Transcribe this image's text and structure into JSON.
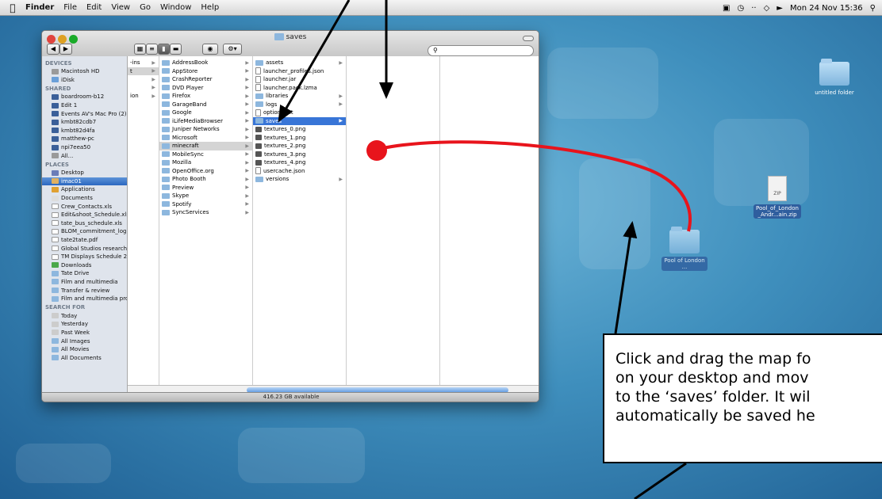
{
  "menubar": {
    "apple": "",
    "items": [
      "Finder",
      "File",
      "Edit",
      "View",
      "Go",
      "Window",
      "Help"
    ],
    "clock": "Mon 24 Nov 15:36"
  },
  "finder": {
    "title": "saves",
    "status": "416.23 GB available",
    "sidebar": [
      {
        "type": "head",
        "label": "DEVICES"
      },
      {
        "label": "Macintosh HD",
        "icon": "hard-drive-icon"
      },
      {
        "label": "iDisk",
        "icon": "idisk-icon"
      },
      {
        "type": "head",
        "label": "SHARED"
      },
      {
        "label": "boardroom-b12",
        "icon": "computer-icon"
      },
      {
        "label": "Edit 1",
        "icon": "computer-icon"
      },
      {
        "label": "Events AV's Mac Pro (2)",
        "icon": "computer-icon"
      },
      {
        "label": "kmbt82cdb7",
        "icon": "computer-icon"
      },
      {
        "label": "kmbt82d4fa",
        "icon": "computer-icon"
      },
      {
        "label": "matthew-pc",
        "icon": "computer-icon"
      },
      {
        "label": "npi7eea50",
        "icon": "computer-icon"
      },
      {
        "label": "All...",
        "icon": "network-icon"
      },
      {
        "type": "head",
        "label": "PLACES"
      },
      {
        "label": "Desktop",
        "icon": "desktop-icon"
      },
      {
        "label": "imac01",
        "icon": "home-icon",
        "selected": true
      },
      {
        "label": "Applications",
        "icon": "applications-icon"
      },
      {
        "label": "Documents",
        "icon": "documents-icon"
      },
      {
        "label": "Crew_Contacts.xls",
        "icon": "document-icon"
      },
      {
        "label": "Edit&shoot_Schedule.xls",
        "icon": "document-icon"
      },
      {
        "label": "tate_bus_schedule.xls",
        "icon": "document-icon"
      },
      {
        "label": "BLOM_commitment_log ...",
        "icon": "document-icon"
      },
      {
        "label": "tate2tate.pdf",
        "icon": "pdf-icon"
      },
      {
        "label": "Global Studios research ...",
        "icon": "document-icon"
      },
      {
        "label": "TM Displays Schedule 20...",
        "icon": "document-icon"
      },
      {
        "label": "Downloads",
        "icon": "downloads-icon"
      },
      {
        "label": "Tate Drive",
        "icon": "folder-icon"
      },
      {
        "label": "Film and multimedia",
        "icon": "folder-icon"
      },
      {
        "label": "Transfer & review",
        "icon": "folder-icon"
      },
      {
        "label": "Film and multimedia pro...",
        "icon": "folder-icon"
      },
      {
        "type": "head",
        "label": "SEARCH FOR"
      },
      {
        "label": "Today",
        "icon": "clock-icon"
      },
      {
        "label": "Yesterday",
        "icon": "clock-icon"
      },
      {
        "label": "Past Week",
        "icon": "clock-icon"
      },
      {
        "label": "All Images",
        "icon": "folder-icon"
      },
      {
        "label": "All Movies",
        "icon": "folder-icon"
      },
      {
        "label": "All Documents",
        "icon": "folder-icon"
      }
    ],
    "col1_fragments": [
      "-ins",
      "t",
      "",
      "",
      "ion"
    ],
    "col2": [
      "AddressBook",
      "AppStore",
      "CrashReporter",
      "DVD Player",
      "Firefox",
      "GarageBand",
      "Google",
      "iLifeMediaBrowser",
      "Juniper Networks",
      "Microsoft",
      "minecraft",
      "MobileSync",
      "Mozilla",
      "OpenOffice.org",
      "Photo Booth",
      "Preview",
      "Skype",
      "Spotify",
      "SyncServices"
    ],
    "col2_selected": "minecraft",
    "col3": [
      {
        "label": "assets",
        "kind": "folder"
      },
      {
        "label": "launcher_profiles.json",
        "kind": "doc"
      },
      {
        "label": "launcher.jar",
        "kind": "doc"
      },
      {
        "label": "launcher.pack.lzma",
        "kind": "doc"
      },
      {
        "label": "libraries",
        "kind": "folder"
      },
      {
        "label": "logs",
        "kind": "folder"
      },
      {
        "label": "options.txt",
        "kind": "doc"
      },
      {
        "label": "saves",
        "kind": "folder",
        "highlight": true
      },
      {
        "label": "textures_0.png",
        "kind": "img"
      },
      {
        "label": "textures_1.png",
        "kind": "img"
      },
      {
        "label": "textures_2.png",
        "kind": "img"
      },
      {
        "label": "textures_3.png",
        "kind": "img"
      },
      {
        "label": "textures_4.png",
        "kind": "img"
      },
      {
        "label": "usercache.json",
        "kind": "doc"
      },
      {
        "label": "versions",
        "kind": "folder"
      }
    ]
  },
  "desktop": {
    "untitled_folder": "untitled folder",
    "zip_label_1": "Pool_of_London",
    "zip_label_2": "_Andr...ain.zip",
    "zip_badge": "ZIP",
    "dragged_label_1": "Pool of London",
    "dragged_label_2": "..."
  },
  "callout": {
    "lines": [
      "Click and drag the map fo",
      "on your desktop and mov",
      "to the ‘saves’ folder. It wil",
      "automatically be saved he"
    ]
  },
  "colors": {
    "drag_line": "#e8141c",
    "highlight": "#3875d7"
  }
}
